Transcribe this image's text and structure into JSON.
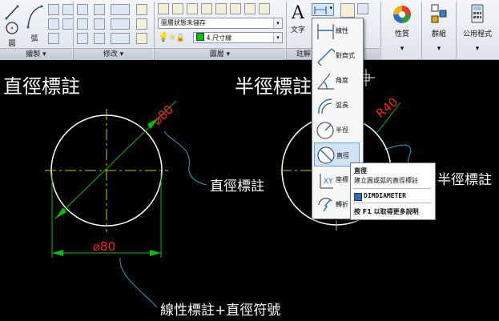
{
  "ribbon": {
    "draw": {
      "line_label": "線",
      "circle_label": "圓",
      "arc_label": "弧",
      "panel_label": "繪製"
    },
    "modify": {
      "panel_label": "修改"
    },
    "layers": {
      "state_combo": "圖層狀態未儲存",
      "layer_combo": "4.尺寸線",
      "panel_label": "圖層",
      "layer_color": "#00c000"
    },
    "annotation": {
      "text_label": "文字",
      "panel_label": "註解"
    },
    "properties": {
      "label": "性質"
    },
    "groups": {
      "label": "群組"
    },
    "utilities": {
      "label": "公用程式"
    },
    "arrow_glyph": "▾"
  },
  "dim_menu": {
    "items": [
      {
        "label": "線性"
      },
      {
        "label": "對齊式"
      },
      {
        "label": "角度"
      },
      {
        "label": "弧長"
      },
      {
        "label": "半徑"
      },
      {
        "label": "直徑"
      },
      {
        "label": "座標"
      },
      {
        "label": "轉折"
      }
    ]
  },
  "tooltip": {
    "title": "直徑",
    "description": "建立圓或弧的直徑標註",
    "command": "DIMDIAMETER",
    "help": "按 F1 以取得更多說明"
  },
  "drawing": {
    "heading_left": "直徑標註",
    "heading_right": "半徑標註",
    "callout_left": "直徑標註",
    "callout_right": "半徑標註",
    "callout_bottom": "線性標註+直徑符號",
    "dim_diameter_text": "⌀80",
    "dim_linear_text": "⌀80",
    "dim_radius_text": "R40",
    "colors": {
      "circle": "#ffffff",
      "dimension": "#00c000",
      "dim_text": "#ff2020",
      "center": "#c8c800",
      "leader": "#22a6c8"
    }
  }
}
